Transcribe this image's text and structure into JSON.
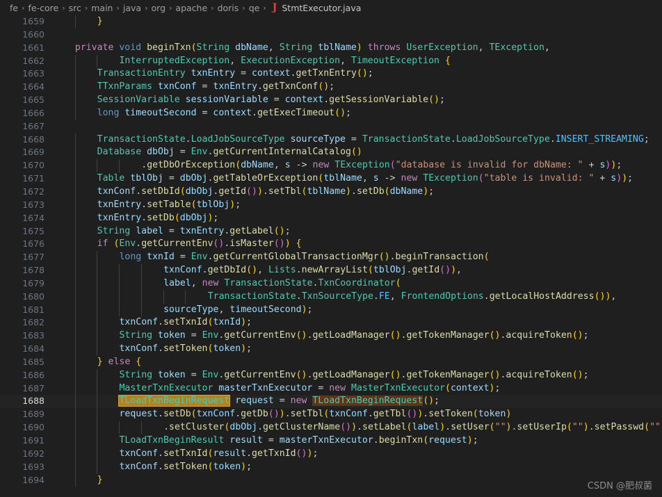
{
  "breadcrumb": {
    "separator": "›",
    "items": [
      "fe",
      "fe-core",
      "src",
      "main",
      "java",
      "org",
      "apache",
      "doris",
      "qe"
    ],
    "file_icon": "java-file-icon",
    "file_icon_glyph": "J",
    "file": "StmtExecutor.java"
  },
  "editor": {
    "active_line": 1688,
    "first_line": 1659,
    "last_line": 1694,
    "selection_text": "TLoadTxnBeginRequest",
    "colors": {
      "background": "#1f1f1f",
      "active_line_background": "#232323",
      "gutter_text": "#6e7681",
      "gutter_active_text": "#dcdcdc",
      "selection_primary": "#b5811b",
      "selection_occurrence": "#623315",
      "type": "#4ec9b0",
      "variable": "#9cdcfe",
      "keyword": "#c586c0",
      "keyword_blue": "#569cd6",
      "method": "#dcdcaa",
      "string": "#ce9178",
      "constant": "#4fc1ff"
    },
    "lines": [
      {
        "n": 1659,
        "text": "        }"
      },
      {
        "n": 1660,
        "text": ""
      },
      {
        "n": 1661,
        "text": "    private void beginTxn(String dbName, String tblName) throws UserException, TException,"
      },
      {
        "n": 1662,
        "text": "            InterruptedException, ExecutionException, TimeoutException {"
      },
      {
        "n": 1663,
        "text": "        TransactionEntry txnEntry = context.getTxnEntry();"
      },
      {
        "n": 1664,
        "text": "        TTxnParams txnConf = txnEntry.getTxnConf();"
      },
      {
        "n": 1665,
        "text": "        SessionVariable sessionVariable = context.getSessionVariable();"
      },
      {
        "n": 1666,
        "text": "        long timeoutSecond = context.getExecTimeout();"
      },
      {
        "n": 1667,
        "text": ""
      },
      {
        "n": 1668,
        "text": "        TransactionState.LoadJobSourceType sourceType = TransactionState.LoadJobSourceType.INSERT_STREAMING;"
      },
      {
        "n": 1669,
        "text": "        Database dbObj = Env.getCurrentInternalCatalog()"
      },
      {
        "n": 1670,
        "text": "                .getDbOrException(dbName, s -> new TException(\"database is invalid for dbName: \" + s));"
      },
      {
        "n": 1671,
        "text": "        Table tblObj = dbObj.getTableOrException(tblName, s -> new TException(\"table is invalid: \" + s));"
      },
      {
        "n": 1672,
        "text": "        txnConf.setDbId(dbObj.getId()).setTbl(tblName).setDb(dbName);"
      },
      {
        "n": 1673,
        "text": "        txnEntry.setTable(tblObj);"
      },
      {
        "n": 1674,
        "text": "        txnEntry.setDb(dbObj);"
      },
      {
        "n": 1675,
        "text": "        String label = txnEntry.getLabel();"
      },
      {
        "n": 1676,
        "text": "        if (Env.getCurrentEnv().isMaster()) {"
      },
      {
        "n": 1677,
        "text": "            long txnId = Env.getCurrentGlobalTransactionMgr().beginTransaction("
      },
      {
        "n": 1678,
        "text": "                    txnConf.getDbId(), Lists.newArrayList(tblObj.getId()),"
      },
      {
        "n": 1679,
        "text": "                    label, new TransactionState.TxnCoordinator("
      },
      {
        "n": 1680,
        "text": "                            TransactionState.TxnSourceType.FE, FrontendOptions.getLocalHostAddress()),"
      },
      {
        "n": 1681,
        "text": "                    sourceType, timeoutSecond);"
      },
      {
        "n": 1682,
        "text": "            txnConf.setTxnId(txnId);"
      },
      {
        "n": 1683,
        "text": "            String token = Env.getCurrentEnv().getLoadManager().getTokenManager().acquireToken();"
      },
      {
        "n": 1684,
        "text": "            txnConf.setToken(token);"
      },
      {
        "n": 1685,
        "text": "        } else {"
      },
      {
        "n": 1686,
        "text": "            String token = Env.getCurrentEnv().getLoadManager().getTokenManager().acquireToken();"
      },
      {
        "n": 1687,
        "text": "            MasterTxnExecutor masterTxnExecutor = new MasterTxnExecutor(context);"
      },
      {
        "n": 1688,
        "text": "            TLoadTxnBeginRequest request = new TLoadTxnBeginRequest();"
      },
      {
        "n": 1689,
        "text": "            request.setDb(txnConf.getDb()).setTbl(txnConf.getTbl()).setToken(token)"
      },
      {
        "n": 1690,
        "text": "                    .setCluster(dbObj.getClusterName()).setLabel(label).setUser(\"\").setUserIp(\"\").setPasswd(\"\");"
      },
      {
        "n": 1691,
        "text": "            TLoadTxnBeginResult result = masterTxnExecutor.beginTxn(request);"
      },
      {
        "n": 1692,
        "text": "            txnConf.setTxnId(result.getTxnId());"
      },
      {
        "n": 1693,
        "text": "            txnConf.setToken(token);"
      },
      {
        "n": 1694,
        "text": "        }"
      }
    ]
  },
  "watermark": "CSDN @肥叔菌"
}
